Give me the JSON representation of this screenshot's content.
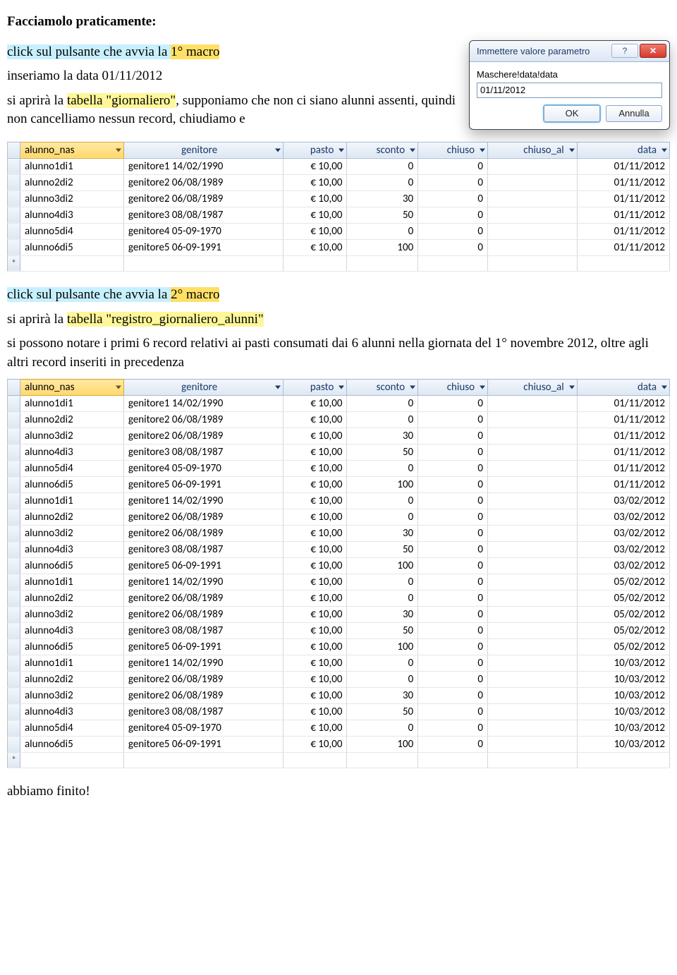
{
  "heading": "Facciamolo praticamente:",
  "intro": {
    "line1a": "click sul pulsante che avvia la ",
    "line1b": "1° macro",
    "line2": "inseriamo la data 01/11/2012",
    "line3a": "si aprirà la ",
    "line3b": "tabella \"giornaliero\"",
    "line3c": ", supponiamo che non ci siano alunni assenti, quindi non cancelliamo nessun record, chiudiamo e"
  },
  "dialog": {
    "title": "Immettere valore parametro",
    "label": "Maschere!data!data",
    "value": "01/11/2012",
    "ok": "OK",
    "cancel": "Annulla"
  },
  "columns": [
    "alunno_nas",
    "genitore",
    "pasto",
    "sconto",
    "chiuso",
    "chiuso_al",
    "data"
  ],
  "table1_rows": [
    [
      "alunno1di1",
      "genitore1 14/02/1990",
      "€ 10,00",
      "0",
      "0",
      "",
      "01/11/2012"
    ],
    [
      "alunno2di2",
      "genitore2 06/08/1989",
      "€ 10,00",
      "0",
      "0",
      "",
      "01/11/2012"
    ],
    [
      "alunno3di2",
      "genitore2 06/08/1989",
      "€ 10,00",
      "30",
      "0",
      "",
      "01/11/2012"
    ],
    [
      "alunno4di3",
      "genitore3 08/08/1987",
      "€ 10,00",
      "50",
      "0",
      "",
      "01/11/2012"
    ],
    [
      "alunno5di4",
      "genitore4 05-09-1970",
      "€ 10,00",
      "0",
      "0",
      "",
      "01/11/2012"
    ],
    [
      "alunno6di5",
      "genitore5 06-09-1991",
      "€ 10,00",
      "100",
      "0",
      "",
      "01/11/2012"
    ]
  ],
  "mid": {
    "line1a": "click sul pulsante che avvia la ",
    "line1b": "2° macro",
    "line2a": "si aprirà la ",
    "line2b": "tabella \"registro_giornaliero_alunni\"",
    "line3": "si possono notare i primi 6 record relativi ai pasti consumati dai 6 alunni nella giornata del 1° novembre 2012, oltre agli altri record inseriti in precedenza"
  },
  "table2_rows": [
    [
      "alunno1di1",
      "genitore1 14/02/1990",
      "€ 10,00",
      "0",
      "0",
      "",
      "01/11/2012"
    ],
    [
      "alunno2di2",
      "genitore2 06/08/1989",
      "€ 10,00",
      "0",
      "0",
      "",
      "01/11/2012"
    ],
    [
      "alunno3di2",
      "genitore2 06/08/1989",
      "€ 10,00",
      "30",
      "0",
      "",
      "01/11/2012"
    ],
    [
      "alunno4di3",
      "genitore3 08/08/1987",
      "€ 10,00",
      "50",
      "0",
      "",
      "01/11/2012"
    ],
    [
      "alunno5di4",
      "genitore4 05-09-1970",
      "€ 10,00",
      "0",
      "0",
      "",
      "01/11/2012"
    ],
    [
      "alunno6di5",
      "genitore5 06-09-1991",
      "€ 10,00",
      "100",
      "0",
      "",
      "01/11/2012"
    ],
    [
      "alunno1di1",
      "genitore1 14/02/1990",
      "€ 10,00",
      "0",
      "0",
      "",
      "03/02/2012"
    ],
    [
      "alunno2di2",
      "genitore2 06/08/1989",
      "€ 10,00",
      "0",
      "0",
      "",
      "03/02/2012"
    ],
    [
      "alunno3di2",
      "genitore2 06/08/1989",
      "€ 10,00",
      "30",
      "0",
      "",
      "03/02/2012"
    ],
    [
      "alunno4di3",
      "genitore3 08/08/1987",
      "€ 10,00",
      "50",
      "0",
      "",
      "03/02/2012"
    ],
    [
      "alunno6di5",
      "genitore5 06-09-1991",
      "€ 10,00",
      "100",
      "0",
      "",
      "03/02/2012"
    ],
    [
      "alunno1di1",
      "genitore1 14/02/1990",
      "€ 10,00",
      "0",
      "0",
      "",
      "05/02/2012"
    ],
    [
      "alunno2di2",
      "genitore2 06/08/1989",
      "€ 10,00",
      "0",
      "0",
      "",
      "05/02/2012"
    ],
    [
      "alunno3di2",
      "genitore2 06/08/1989",
      "€ 10,00",
      "30",
      "0",
      "",
      "05/02/2012"
    ],
    [
      "alunno4di3",
      "genitore3 08/08/1987",
      "€ 10,00",
      "50",
      "0",
      "",
      "05/02/2012"
    ],
    [
      "alunno6di5",
      "genitore5 06-09-1991",
      "€ 10,00",
      "100",
      "0",
      "",
      "05/02/2012"
    ],
    [
      "alunno1di1",
      "genitore1 14/02/1990",
      "€ 10,00",
      "0",
      "0",
      "",
      "10/03/2012"
    ],
    [
      "alunno2di2",
      "genitore2 06/08/1989",
      "€ 10,00",
      "0",
      "0",
      "",
      "10/03/2012"
    ],
    [
      "alunno3di2",
      "genitore2 06/08/1989",
      "€ 10,00",
      "30",
      "0",
      "",
      "10/03/2012"
    ],
    [
      "alunno4di3",
      "genitore3 08/08/1987",
      "€ 10,00",
      "50",
      "0",
      "",
      "10/03/2012"
    ],
    [
      "alunno5di4",
      "genitore4 05-09-1970",
      "€ 10,00",
      "0",
      "0",
      "",
      "10/03/2012"
    ],
    [
      "alunno6di5",
      "genitore5 06-09-1991",
      "€ 10,00",
      "100",
      "0",
      "",
      "10/03/2012"
    ]
  ],
  "footer": "abbiamo finito!",
  "newrow_glyph": "*"
}
